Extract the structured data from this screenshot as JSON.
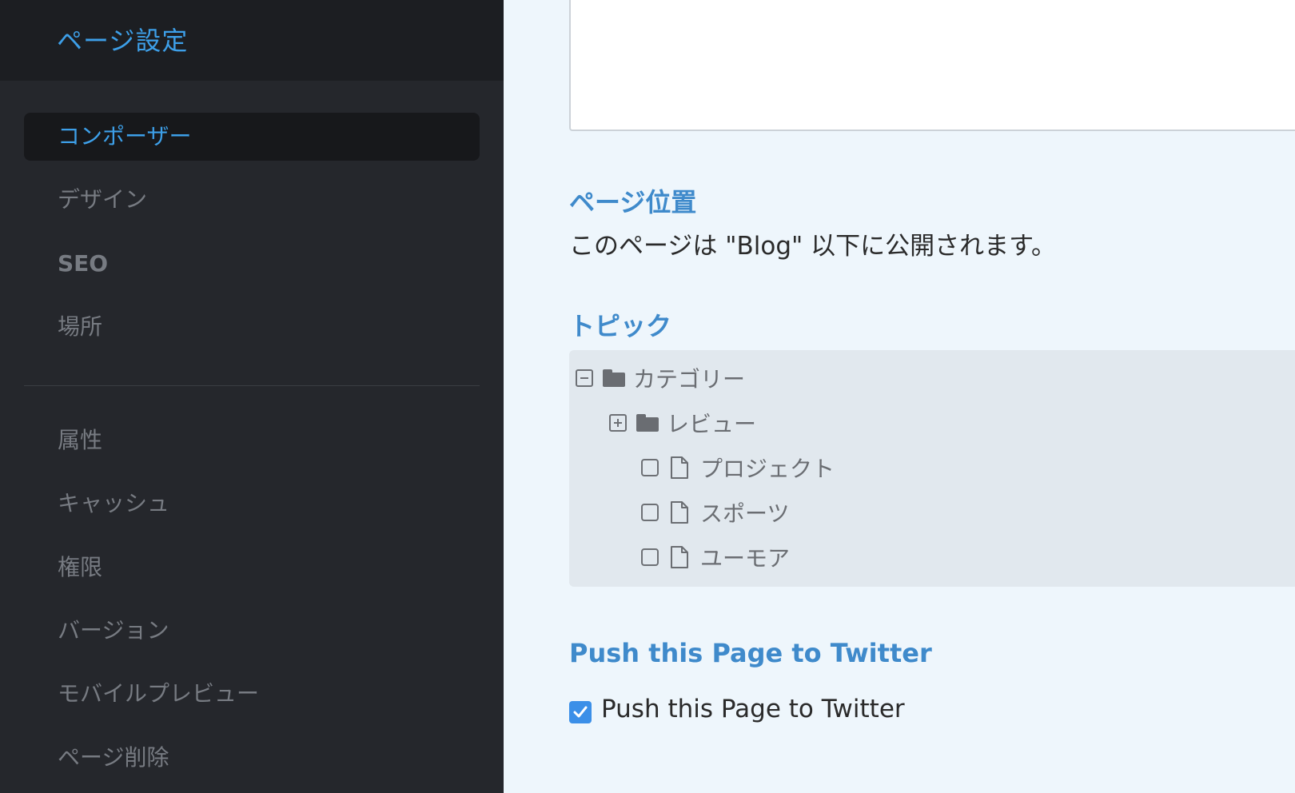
{
  "sidebar": {
    "title": "ページ設定",
    "items_top": [
      {
        "label": "コンポーザー",
        "active": true
      },
      {
        "label": "デザイン"
      },
      {
        "label": "SEO"
      },
      {
        "label": "場所"
      }
    ],
    "items_bottom": [
      {
        "label": "属性"
      },
      {
        "label": "キャッシュ"
      },
      {
        "label": "権限"
      },
      {
        "label": "バージョン"
      },
      {
        "label": "モバイルプレビュー"
      },
      {
        "label": "ページ削除"
      }
    ]
  },
  "main": {
    "location": {
      "heading": "ページ位置",
      "text": "このページは \"Blog\" 以下に公開されます。"
    },
    "topics": {
      "heading": "トピック",
      "tree": [
        {
          "label": "カテゴリー",
          "type": "folder",
          "toggle": "collapse"
        },
        {
          "label": "レビュー",
          "type": "folder",
          "toggle": "expand"
        },
        {
          "label": "プロジェクト",
          "type": "file",
          "checked": false
        },
        {
          "label": "スポーツ",
          "type": "file",
          "checked": false
        },
        {
          "label": "ユーモア",
          "type": "file",
          "checked": false
        }
      ]
    },
    "twitter": {
      "heading": "Push this Page to Twitter",
      "checkbox_label": "Push this Page to Twitter",
      "checked": true
    }
  },
  "colors": {
    "accent": "#3d9fe8",
    "heading": "#3f8acb",
    "sidebar_bg": "#25272c",
    "main_bg": "#eef6fc"
  }
}
